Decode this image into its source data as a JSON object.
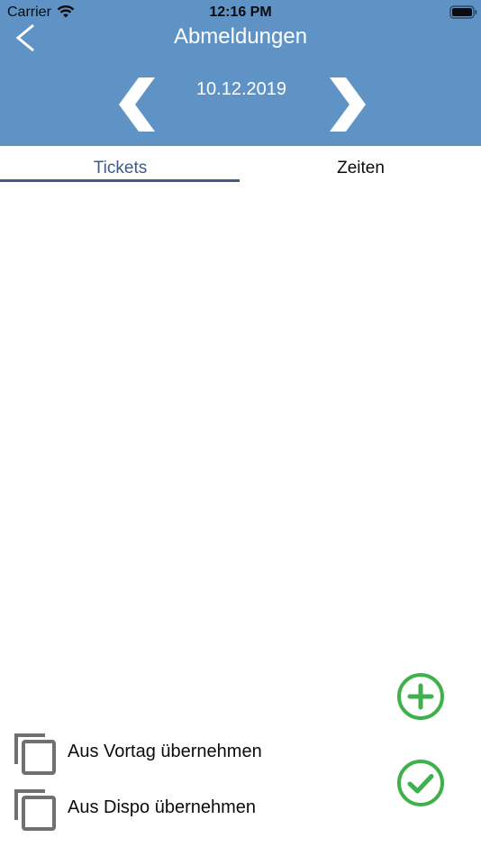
{
  "status_bar": {
    "carrier": "Carrier",
    "time": "12:16 PM"
  },
  "header": {
    "title": "Abmeldungen",
    "date": "10.12.2019",
    "color": "#5f93c6"
  },
  "tabs": [
    {
      "label": "Tickets",
      "selected": true,
      "color": "#3d5a8b"
    },
    {
      "label": "Zeiten",
      "selected": false,
      "color": "#0b0b0b"
    }
  ],
  "actions": {
    "vortag_label": "Aus Vortag übernehmen",
    "dispo_label": "Aus Dispo übernehmen"
  },
  "icons": {
    "back": "chevron-left-icon",
    "prev_date": "chevron-left-icon",
    "next_date": "chevron-right-icon",
    "add": "plus-circle-icon",
    "confirm": "check-circle-icon",
    "copy": "copy-icon",
    "wifi": "wifi-icon",
    "battery": "battery-icon"
  },
  "colors": {
    "accent_green": "#3fb14c",
    "icon_gray": "#707070"
  }
}
